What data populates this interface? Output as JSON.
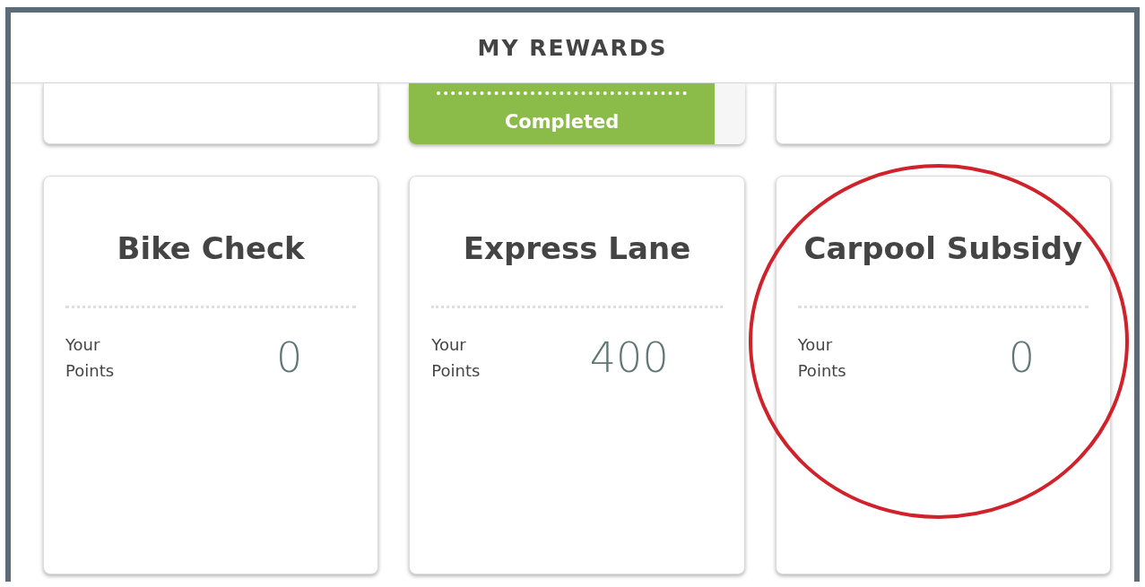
{
  "header": {
    "title": "MY REWARDS"
  },
  "top_row": [
    {
      "kind": "empty"
    },
    {
      "kind": "progress",
      "level": 0.91,
      "label": "Completed"
    },
    {
      "kind": "empty"
    }
  ],
  "rewards": [
    {
      "title": "Bike Check",
      "points_label": "Your Points",
      "points": "0",
      "highlighted": false
    },
    {
      "title": "Express Lane",
      "points_label": "Your Points",
      "points": "400",
      "highlighted": false
    },
    {
      "title": "Carpool Subsidy",
      "points_label": "Your Points",
      "points": "0",
      "highlighted": true
    }
  ]
}
